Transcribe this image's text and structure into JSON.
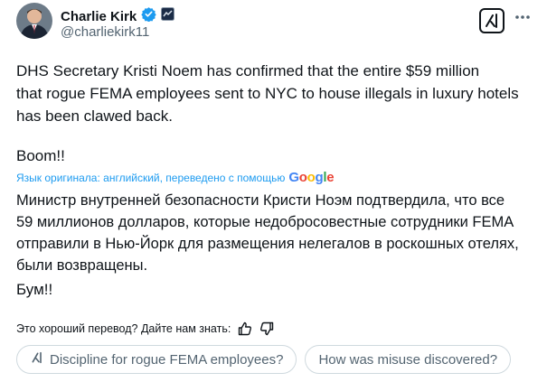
{
  "author": {
    "name": "Charlie Kirk",
    "handle": "@charliekirk11"
  },
  "tweet": {
    "original_text": "DHS Secretary Kristi Noem has confirmed that the entire $59 million\nthat rogue FEMA employees sent to NYC to house illegals in luxury hotels\nhas been clawed back.",
    "original_closing": "Boom!!",
    "translation_notice": "Язык оригинала: английский, переведено с помощью",
    "translation_provider": "Google",
    "translated_text": "Министр внутренней безопасности Кристи Ноэм подтвердила, что все\n59 миллионов долларов, которые недобросовестные сотрудники FEMA\nотправили в Нью-Йорк для размещения нелегалов в роскошных отелях,\nбыли возвращены.",
    "translated_closing": "Бум!!"
  },
  "feedback": {
    "question": "Это хороший перевод? Дайте нам знать:"
  },
  "suggestions": [
    "Discipline for rogue FEMA employees?",
    "How was misuse discovered?"
  ],
  "icons": {
    "verified": "verified-badge-icon",
    "affiliate": "affiliate-badge-icon",
    "grok": "grok-icon",
    "more": "more-icon",
    "thumbs_up": "thumbs-up-icon",
    "thumbs_down": "thumbs-down-icon"
  },
  "colors": {
    "accent": "#1d9bf0",
    "text": "#0f1419",
    "muted": "#536471",
    "border": "#cfd9de"
  }
}
